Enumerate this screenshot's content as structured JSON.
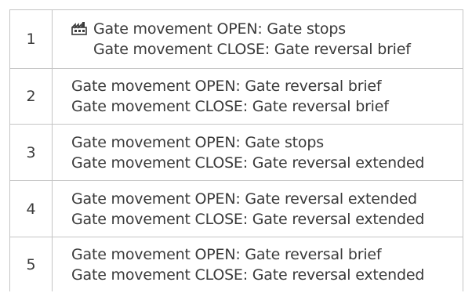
{
  "rows": [
    {
      "number": "1",
      "icon": "factory-icon",
      "line1": "Gate movement OPEN: Gate stops",
      "line2": "Gate movement CLOSE: Gate reversal brief"
    },
    {
      "number": "2",
      "line1": "Gate movement OPEN: Gate reversal brief",
      "line2": "Gate movement CLOSE: Gate reversal brief"
    },
    {
      "number": "3",
      "line1": "Gate movement OPEN: Gate stops",
      "line2": "Gate movement CLOSE: Gate reversal extended"
    },
    {
      "number": "4",
      "line1": "Gate movement OPEN: Gate reversal extended",
      "line2": "Gate movement CLOSE: Gate reversal extended"
    },
    {
      "number": "5",
      "line1": "Gate movement OPEN: Gate reversal brief",
      "line2": "Gate movement CLOSE: Gate reversal extended"
    }
  ]
}
